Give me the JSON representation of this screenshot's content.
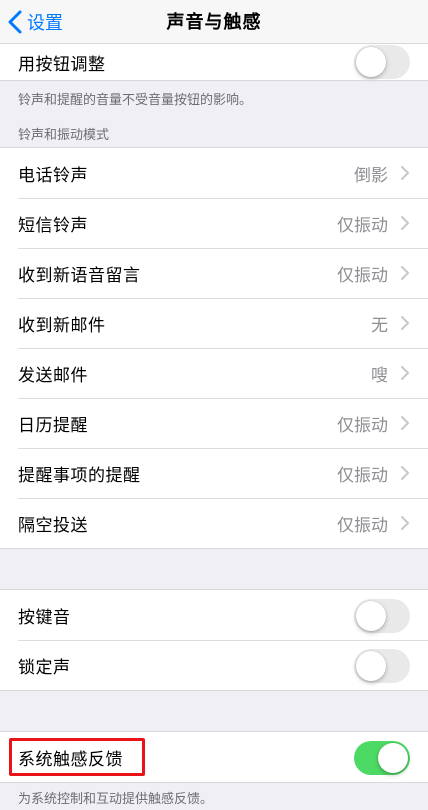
{
  "nav": {
    "back_label": "设置",
    "title": "声音与触感"
  },
  "top_row": {
    "label": "用按钮调整",
    "toggle_on": false
  },
  "top_footer": "铃声和提醒的音量不受音量按钮的影响。",
  "ringtone_section": {
    "header": "铃声和振动模式",
    "items": [
      {
        "label": "电话铃声",
        "value": "倒影"
      },
      {
        "label": "短信铃声",
        "value": "仅振动"
      },
      {
        "label": "收到新语音留言",
        "value": "仅振动"
      },
      {
        "label": "收到新邮件",
        "value": "无"
      },
      {
        "label": "发送邮件",
        "value": "嗖"
      },
      {
        "label": "日历提醒",
        "value": "仅振动"
      },
      {
        "label": "提醒事项的提醒",
        "value": "仅振动"
      },
      {
        "label": "隔空投送",
        "value": "仅振动"
      }
    ]
  },
  "sounds_section": {
    "items": [
      {
        "label": "按键音",
        "toggle_on": false
      },
      {
        "label": "锁定声",
        "toggle_on": false
      }
    ]
  },
  "haptics_section": {
    "label": "系统触感反馈",
    "toggle_on": true,
    "footer": "为系统控制和互动提供触感反馈。"
  },
  "colors": {
    "accent": "#007aff",
    "toggle_on": "#4cd964",
    "highlight": "#e8141a"
  },
  "icons": {
    "back": "chevron-left-icon",
    "disclosure": "chevron-right-icon"
  }
}
